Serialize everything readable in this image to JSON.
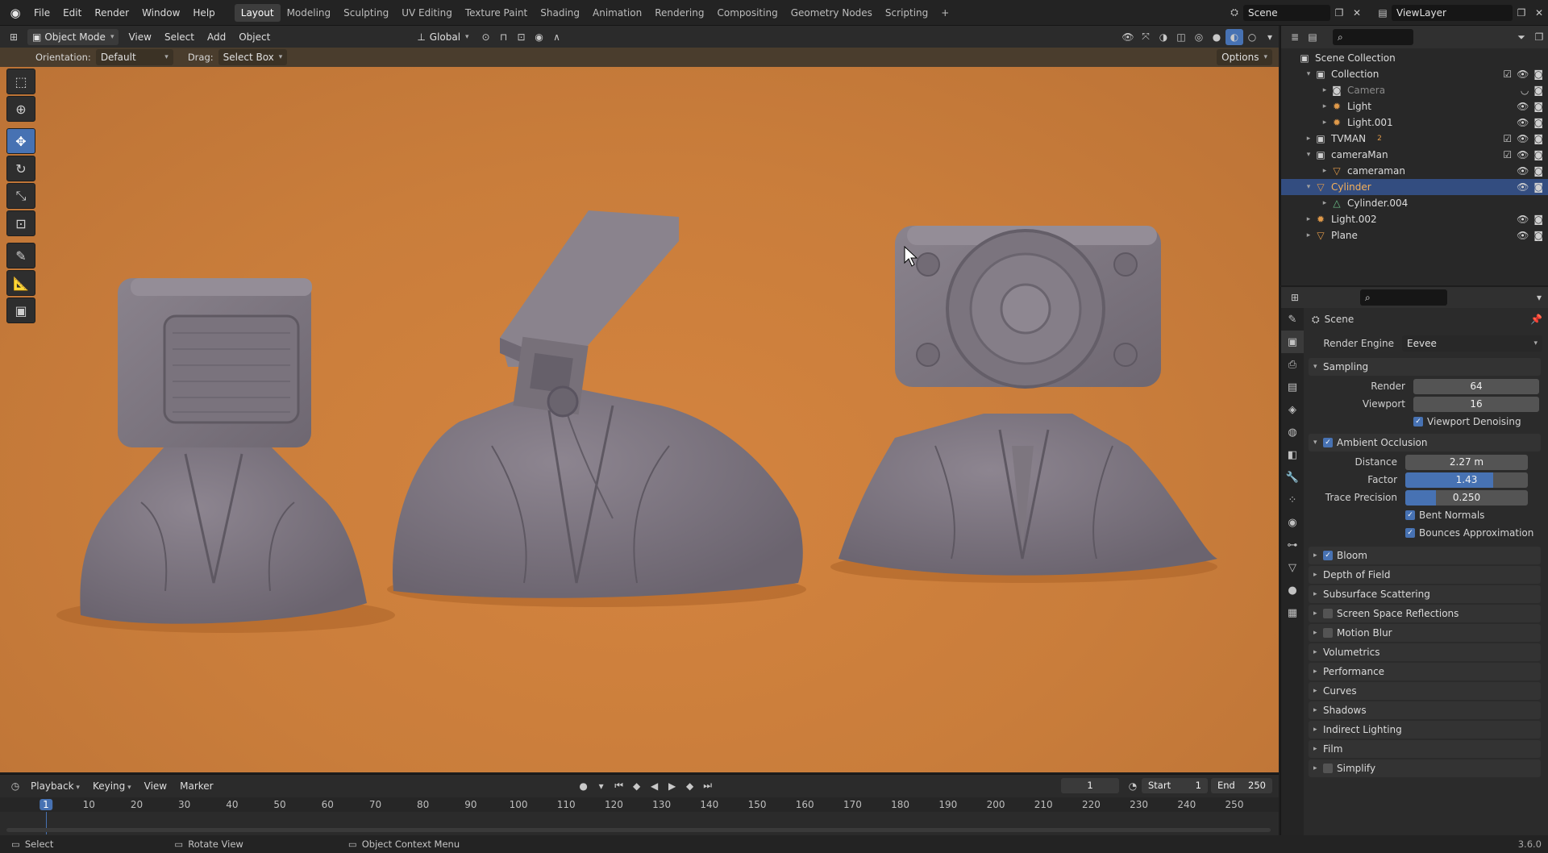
{
  "topbar": {
    "menus": [
      "File",
      "Edit",
      "Render",
      "Window",
      "Help"
    ],
    "workspaces": [
      "Layout",
      "Modeling",
      "Sculpting",
      "UV Editing",
      "Texture Paint",
      "Shading",
      "Animation",
      "Rendering",
      "Compositing",
      "Geometry Nodes",
      "Scripting"
    ],
    "active_workspace": "Layout",
    "add_tab": "+",
    "scene_name": "Scene",
    "view_layer": "ViewLayer"
  },
  "viewport_header": {
    "mode": "Object Mode",
    "menus": [
      "View",
      "Select",
      "Add",
      "Object"
    ],
    "transform_orientation": "Global"
  },
  "tool_header": {
    "orientation_label": "Orientation:",
    "orientation_value": "Default",
    "drag_label": "Drag:",
    "drag_value": "Select Box",
    "options_label": "Options"
  },
  "toolbar": {
    "tools": [
      "select-box",
      "cursor",
      "move",
      "rotate",
      "scale",
      "transform",
      "annotate",
      "measure",
      "add-cube"
    ],
    "active_tool": "move"
  },
  "outliner": {
    "rows": [
      {
        "label": "Scene Collection",
        "indent": 0,
        "icon": "scene-collection-icon",
        "twisty": ""
      },
      {
        "label": "Collection",
        "indent": 1,
        "icon": "collection-icon",
        "twisty": "▾",
        "check": true,
        "eye": true,
        "cam": true
      },
      {
        "label": "Camera",
        "indent": 2,
        "icon": "camera-icon",
        "twisty": "▸",
        "dim": true,
        "eye": false,
        "cam": true
      },
      {
        "label": "Light",
        "indent": 2,
        "icon": "light-icon",
        "twisty": "▸",
        "eye": true,
        "cam": true
      },
      {
        "label": "Light.001",
        "indent": 2,
        "icon": "light-icon",
        "twisty": "▸",
        "eye": true,
        "cam": true
      },
      {
        "label": "TVMAN",
        "indent": 1,
        "icon": "collection-icon",
        "twisty": "▸",
        "check": true,
        "eye": true,
        "cam": true,
        "badge": "2"
      },
      {
        "label": "cameraMan",
        "indent": 1,
        "icon": "collection-icon",
        "twisty": "▾",
        "check": true,
        "eye": true,
        "cam": true
      },
      {
        "label": "cameraman",
        "indent": 2,
        "icon": "mesh-icon",
        "twisty": "▸",
        "eye": true,
        "cam": true
      },
      {
        "label": "Cylinder",
        "indent": 1,
        "icon": "mesh-icon",
        "twisty": "▾",
        "selected": true,
        "eye": true,
        "cam": true
      },
      {
        "label": "Cylinder.004",
        "indent": 2,
        "icon": "mesh-data-icon",
        "twisty": "▸"
      },
      {
        "label": "Light.002",
        "indent": 1,
        "icon": "light-icon",
        "twisty": "▸",
        "eye": true,
        "cam": true
      },
      {
        "label": "Plane",
        "indent": 1,
        "icon": "mesh-icon",
        "twisty": "▸",
        "eye": true,
        "cam": true
      }
    ]
  },
  "properties": {
    "context_title": "Scene",
    "render_engine_label": "Render Engine",
    "render_engine_value": "Eevee",
    "sampling": {
      "title": "Sampling",
      "render_label": "Render",
      "render_value": "64",
      "viewport_label": "Viewport",
      "viewport_value": "16",
      "denoise_label": "Viewport Denoising"
    },
    "ao": {
      "title": "Ambient Occlusion",
      "distance_label": "Distance",
      "distance_value": "2.27 m",
      "factor_label": "Factor",
      "factor_value": "1.43",
      "factor_fill": 0.72,
      "trace_label": "Trace Precision",
      "trace_value": "0.250",
      "trace_fill": 0.25,
      "bent_label": "Bent Normals",
      "bounces_label": "Bounces Approximation"
    },
    "panels": [
      {
        "label": "Bloom",
        "checkbox": true,
        "checked": true
      },
      {
        "label": "Depth of Field",
        "checkbox": false
      },
      {
        "label": "Subsurface Scattering",
        "checkbox": false
      },
      {
        "label": "Screen Space Reflections",
        "checkbox": true,
        "checked": false
      },
      {
        "label": "Motion Blur",
        "checkbox": true,
        "checked": false
      },
      {
        "label": "Volumetrics",
        "checkbox": false
      },
      {
        "label": "Performance",
        "checkbox": false
      },
      {
        "label": "Curves",
        "checkbox": false
      },
      {
        "label": "Shadows",
        "checkbox": false
      },
      {
        "label": "Indirect Lighting",
        "checkbox": false
      },
      {
        "label": "Film",
        "checkbox": false
      },
      {
        "label": "Simplify",
        "checkbox": true,
        "checked": false
      }
    ]
  },
  "timeline": {
    "menus": [
      "Playback",
      "Keying",
      "View",
      "Marker"
    ],
    "current_frame": "1",
    "start_label": "Start",
    "start_value": "1",
    "end_label": "End",
    "end_value": "250",
    "ticks": [
      "1",
      "10",
      "20",
      "30",
      "40",
      "50",
      "60",
      "70",
      "80",
      "90",
      "100",
      "110",
      "120",
      "130",
      "140",
      "150",
      "160",
      "170",
      "180",
      "190",
      "200",
      "210",
      "220",
      "230",
      "240",
      "250"
    ]
  },
  "statusbar": {
    "select": "Select",
    "rotate": "Rotate View",
    "context": "Object Context Menu",
    "version": "3.6.0"
  },
  "colors": {
    "accent": "#4772b3",
    "viewport_bg": "#c97d3b",
    "header_tool": "#4a3d2d",
    "selected_row": "#334d80"
  }
}
